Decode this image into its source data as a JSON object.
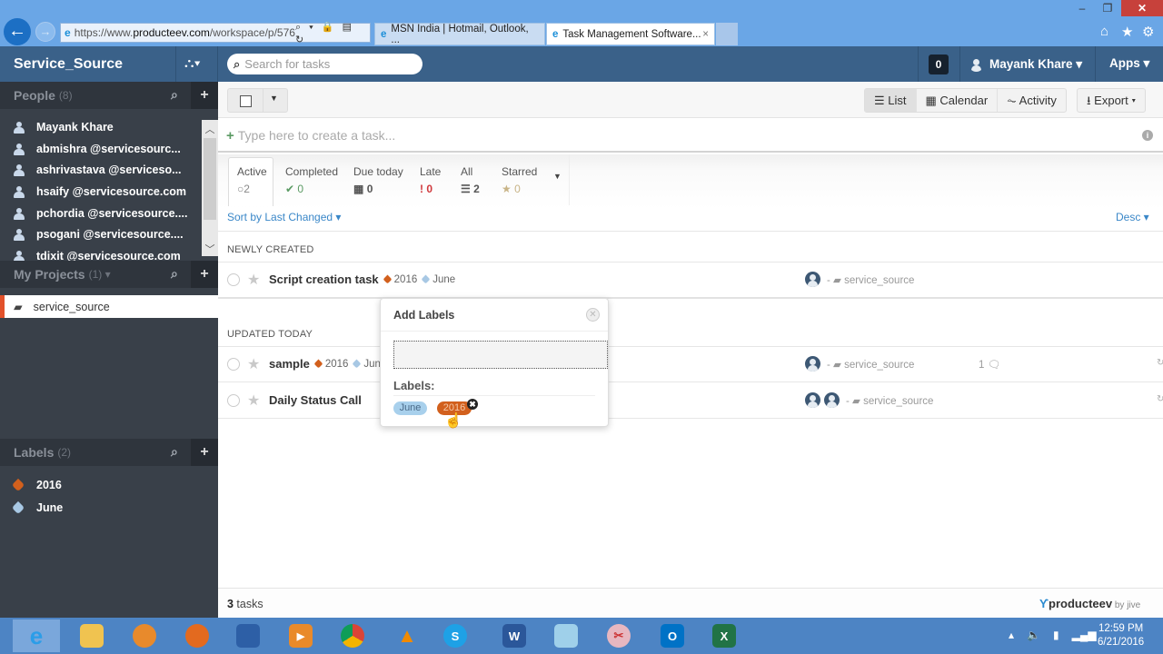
{
  "browser": {
    "url_prefix": "https://www.",
    "url_domain": "producteev.com",
    "url_path": "/workspace/p/576",
    "url_controls": "⌕ ▾ 🔒 ▤ ↻",
    "tabs": [
      {
        "label": "MSN India | Hotmail, Outlook, ...",
        "active": false
      },
      {
        "label": "Task Management Software...",
        "active": true
      }
    ],
    "tab_close": "×",
    "window_controls": {
      "minimize": "–",
      "maximize": "❐",
      "close": "✕"
    },
    "tool_icons": {
      "home": "⌂",
      "favorites": "★",
      "settings": "⚙"
    }
  },
  "topbar": {
    "workspace_name": "Service_Source",
    "org_icon": "⛬▾",
    "search_placeholder": "Search for tasks",
    "notification_count": "0",
    "user_name": "Mayank Khare ▾",
    "apps_label": "Apps ▾"
  },
  "sidebar": {
    "people": {
      "title": "People",
      "count": "(8)",
      "members": [
        "Mayank Khare",
        "abmishra @servicesourc...",
        "ashrivastava @serviceso...",
        "hsaify @servicesource.com",
        "pchordia @servicesource....",
        "psogani @servicesource....",
        "tdixit @servicesource.com"
      ]
    },
    "projects": {
      "title": "My Projects",
      "count": "(1) ▾",
      "items": [
        {
          "name": "service_source",
          "selected": true
        }
      ]
    },
    "labels": {
      "title": "Labels",
      "count": "(2)",
      "items": [
        {
          "name": "2016",
          "color": "#d2601d"
        },
        {
          "name": "June",
          "color": "#a8c8e4"
        }
      ]
    },
    "search_icon": "⌕",
    "add_icon": "+"
  },
  "toolbar": {
    "views": [
      {
        "label": "☰ List",
        "active": true
      },
      {
        "label": "▦ Calendar",
        "active": false
      },
      {
        "label": "⏦ Activity",
        "active": false
      }
    ],
    "export_label": "⭳ Export ▾"
  },
  "create_task": {
    "placeholder": "Type here to create a task..."
  },
  "filters": [
    {
      "label": "Active",
      "icon": "○",
      "count": "2",
      "color": "#888",
      "active": true
    },
    {
      "label": "Completed",
      "icon": "✔",
      "count": "0",
      "color": "#5a9a63",
      "active": false
    },
    {
      "label": "Due today",
      "icon": "▦",
      "count": "0",
      "color": "#555",
      "active": false
    },
    {
      "label": "Late",
      "icon": "!",
      "count": "0",
      "color": "#d0383c",
      "active": false
    },
    {
      "label": "All",
      "icon": "☰",
      "count": "2",
      "color": "#555",
      "active": false
    },
    {
      "label": "Starred",
      "icon": "★",
      "count": "0",
      "color": "#c8b487",
      "active": false
    }
  ],
  "sort": {
    "label": "Sort by Last Changed ▾",
    "order": "Desc ▾"
  },
  "sections": [
    {
      "title": "NEWLY CREATED",
      "tasks": [
        {
          "name": "Script creation task",
          "tags": [
            {
              "name": "2016",
              "color": "#d2601d"
            },
            {
              "name": "June",
              "color": "#a8c8e4"
            }
          ],
          "assignees": 1,
          "project": "service_source",
          "comments": ""
        }
      ]
    },
    {
      "title": "UPDATED TODAY",
      "tasks": [
        {
          "name": "sample",
          "tags": [
            {
              "name": "2016",
              "color": "#d2601d"
            },
            {
              "name": "Jun",
              "color": "#a8c8e4"
            }
          ],
          "assignees": 1,
          "project": "service_source",
          "comments": "1 🗨"
        },
        {
          "name": "Daily Status Call",
          "tags": [],
          "assignees": 2,
          "project": "service_source",
          "comments": ""
        }
      ]
    }
  ],
  "popup": {
    "title": "Add Labels",
    "input_value": "",
    "labels_heading": "Labels:",
    "chips": [
      {
        "name": "June",
        "color": "#a8d0ec"
      },
      {
        "name": "2016",
        "color": "#d2601d"
      }
    ],
    "close_icon": "✕",
    "remove_icon": "✖"
  },
  "footer": {
    "task_count": "3",
    "task_count_suffix": " tasks",
    "brand": "producteev",
    "brand_suffix": " by jive"
  },
  "taskbar": {
    "apps": [
      "Internet Explorer",
      "File Explorer",
      "Headset App",
      "Firefox",
      "Remote Desktop",
      "Media Player",
      "Chrome",
      "VLC",
      "Skype",
      "Word",
      "Notepad",
      "Snipping Tool",
      "Outlook",
      "Excel"
    ],
    "time": "12:59 PM",
    "date": "6/21/2016"
  }
}
